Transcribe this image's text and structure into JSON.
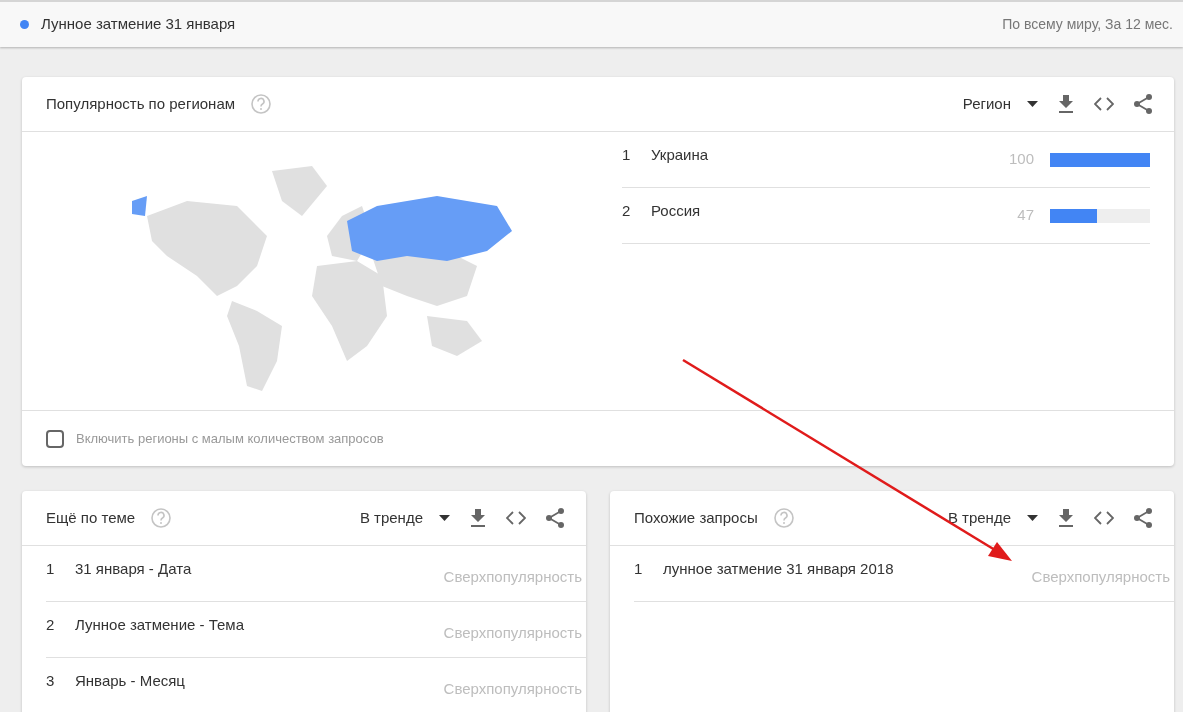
{
  "top_bar": {
    "term": {
      "label": "Лунное затмение 31 января",
      "color": "#4285f4"
    },
    "scope": "По всему миру, За 12 мес."
  },
  "regions_card": {
    "title": "Популярность по регионам",
    "dropdown": "Регион",
    "rows": [
      {
        "rank": "1",
        "name": "Украина",
        "value": "100",
        "level": 1.0
      },
      {
        "rank": "2",
        "name": "Россия",
        "value": "47",
        "level": 0.47
      }
    ],
    "checkbox": {
      "label": "Включить регионы с малым количеством запросов",
      "checked": false
    }
  },
  "topics_card": {
    "title": "Ещё по теме",
    "dropdown": "В тренде",
    "rows": [
      {
        "rank": "1",
        "text": "31 января - Дата",
        "value": "Сверхпопулярность"
      },
      {
        "rank": "2",
        "text": "Лунное затмение - Тема",
        "value": "Сверхпопулярность"
      },
      {
        "rank": "3",
        "text": "Январь - Месяц",
        "value": "Сверхпопулярность"
      }
    ]
  },
  "queries_card": {
    "title": "Похожие запросы",
    "dropdown": "В тренде",
    "rows": [
      {
        "rank": "1",
        "text": "лунное затмение 31 января 2018",
        "value": "Сверхпопулярность"
      }
    ]
  }
}
